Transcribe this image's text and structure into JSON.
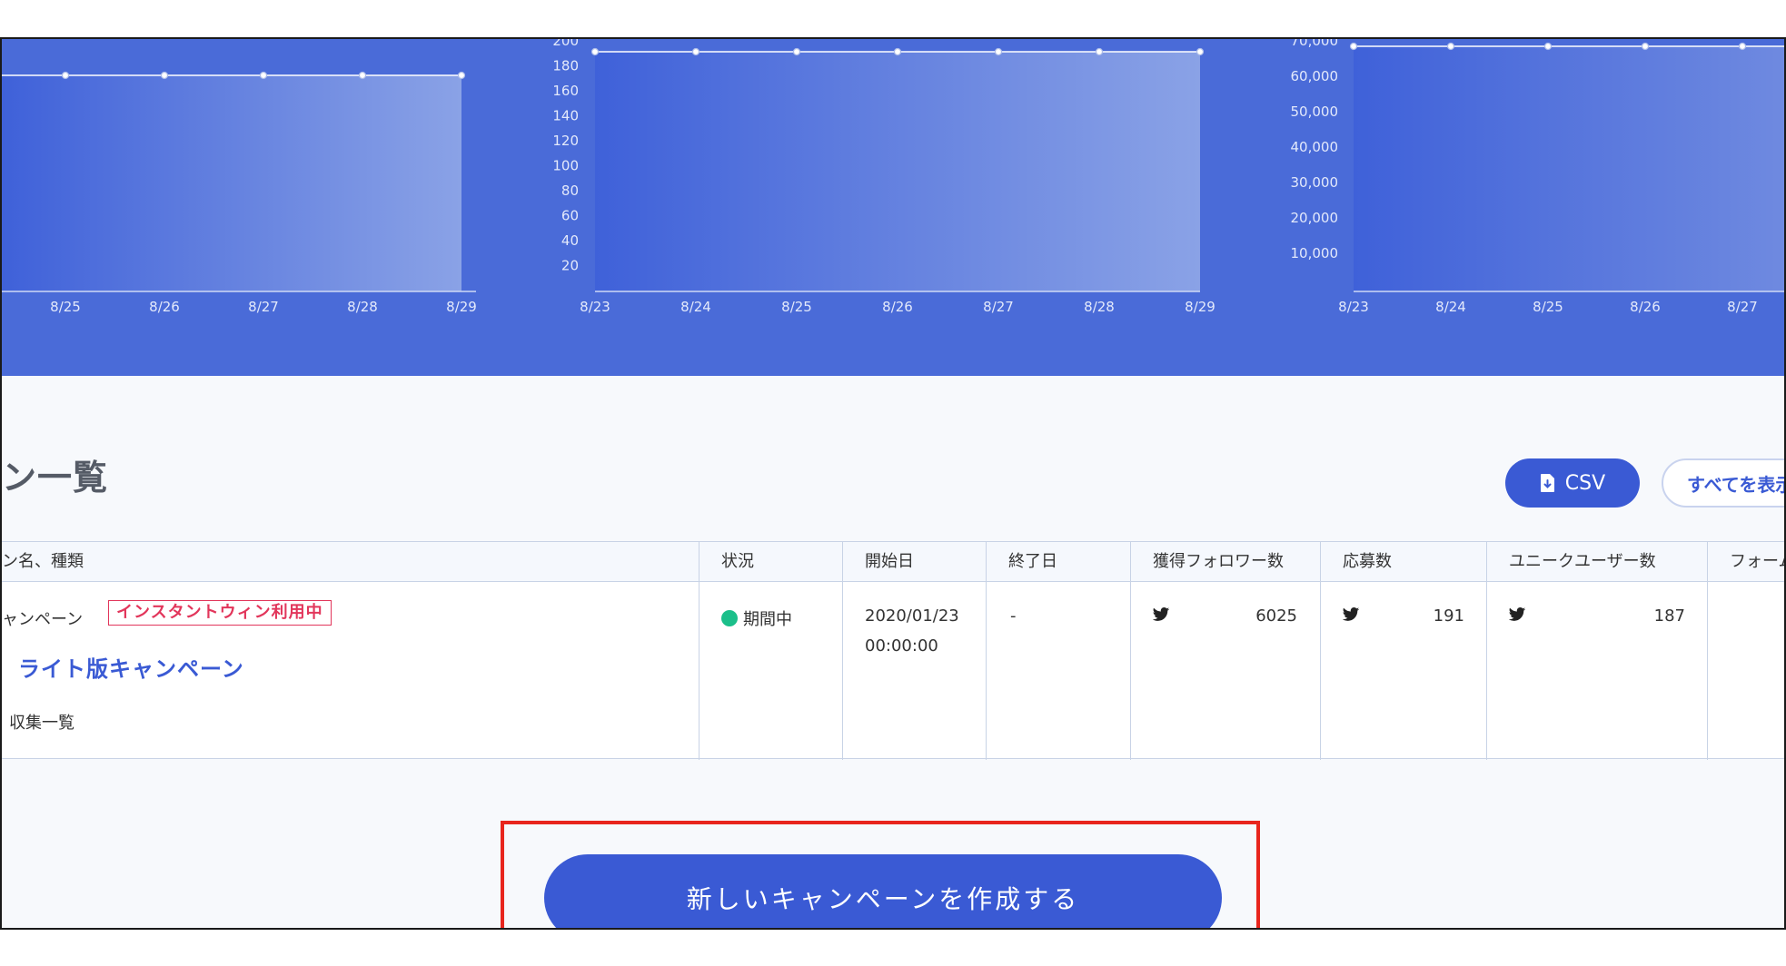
{
  "colors": {
    "band": "#4a6bd8",
    "accent": "#3a5ad4",
    "badge": "#e2365b",
    "status_active": "#1bbf8a",
    "highlight": "#e8251d"
  },
  "charts": [
    {
      "type": "area",
      "x": [
        "8/25",
        "8/26",
        "8/27",
        "8/28",
        "8/29"
      ],
      "y_ticks": []
    },
    {
      "type": "area",
      "x": [
        "8/23",
        "8/24",
        "8/25",
        "8/26",
        "8/27",
        "8/28",
        "8/29"
      ],
      "y_ticks": [
        "200",
        "180",
        "160",
        "140",
        "120",
        "100",
        "80",
        "60",
        "40",
        "20"
      ]
    },
    {
      "type": "area",
      "x": [
        "8/23",
        "8/24",
        "8/25",
        "8/26",
        "8/27"
      ],
      "y_ticks": [
        "70,000",
        "60,000",
        "50,000",
        "40,000",
        "30,000",
        "20,000",
        "10,000"
      ]
    }
  ],
  "section": {
    "title": "ン一覧",
    "csv_label": "CSV",
    "show_all_label": "すべてを表示"
  },
  "table": {
    "headers": [
      "ン名、種類",
      "状況",
      "開始日",
      "終了日",
      "獲得フォロワー数",
      "応募数",
      "ユニークユーザー数",
      "フォーム"
    ],
    "row": {
      "type": "ャンペーン",
      "badge": "インスタントウィン利用中",
      "name": "ライト版キャンペーン",
      "link": "収集一覧",
      "status": "期間中",
      "start_date": "2020/01/23",
      "start_time": "00:00:00",
      "end_date": "-",
      "followers": "6025",
      "entries": "191",
      "unique_users": "187"
    }
  },
  "create_button_label": "新しいキャンペーンを作成する",
  "icons": {
    "csv": "file-download-icon",
    "twitter": "twitter-bird-icon"
  }
}
